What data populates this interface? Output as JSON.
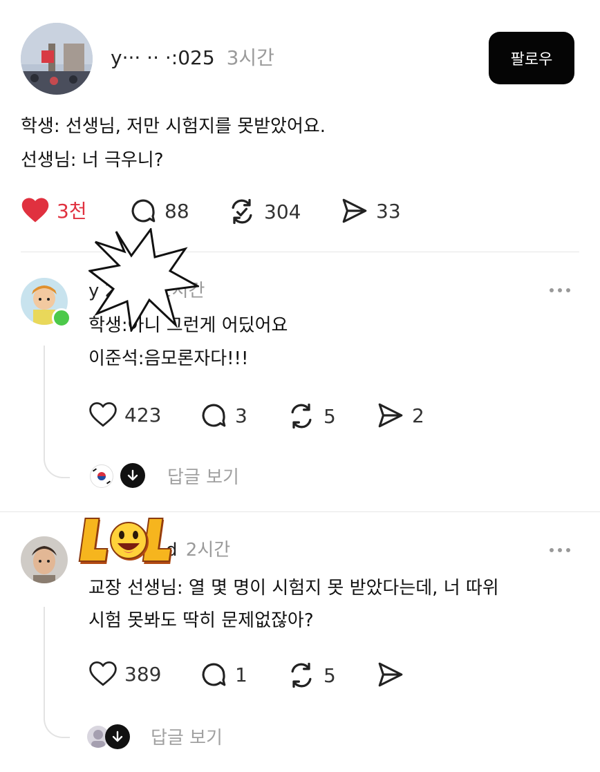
{
  "post": {
    "username": "y··· ·· ·:025",
    "time": "3시간",
    "follow_label": "팔로우",
    "lines": [
      "학생: 선생님, 저만 시험지를 못받았어요.",
      "선생님: 너 극우니?"
    ],
    "likes": "3천",
    "comments": "88",
    "reposts": "304",
    "shares": "33",
    "liked": true,
    "like_color": "#e0313f"
  },
  "replies": [
    {
      "username": "y     2000",
      "time": "2시간",
      "lines": [
        "학생:아니 그런게 어딨어요",
        "이준석:음모론자다!!!"
      ],
      "likes": "423",
      "comments": "3",
      "reposts": "5",
      "shares": "2",
      "online": true,
      "view_replies": "답글 보기"
    },
    {
      "username": "d",
      "time": "2시간",
      "lines": [
        "교장 선생님: 열 몇 명이 시험지 못 받았다는데, 너 따위",
        "시험 못봐도 딱히 문제없잖아?"
      ],
      "likes": "389",
      "comments": "1",
      "reposts": "5",
      "shares": "",
      "view_replies": "답글 보기"
    }
  ],
  "stickers": {
    "lol_text": "LOL"
  },
  "icons": [
    "heart-icon",
    "comment-icon",
    "repost-icon",
    "share-icon",
    "more-icon",
    "arrow-down-icon"
  ]
}
